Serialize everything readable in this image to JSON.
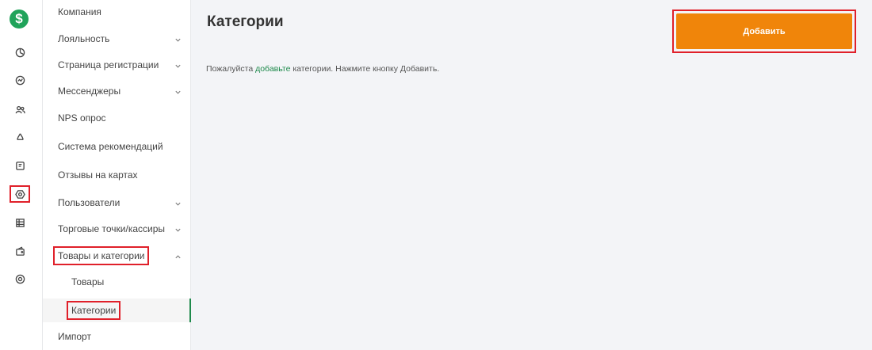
{
  "rail": {
    "logo_glyph": "$",
    "icons": [
      "dashboard-icon",
      "analytics-icon",
      "users-icon",
      "recycle-icon",
      "coupon-icon",
      "settings-icon",
      "table-icon",
      "wallet-icon",
      "support-icon"
    ],
    "active": "settings-icon"
  },
  "sidebar": {
    "items": [
      {
        "label": "Компания"
      },
      {
        "label": "Лояльность",
        "chevron": "down"
      },
      {
        "label": "Страница регистрации",
        "chevron": "down"
      },
      {
        "label": "Мессенджеры",
        "chevron": "down"
      },
      {
        "label": "NPS опрос"
      },
      {
        "label": "Система рекомендаций"
      },
      {
        "label": "Отзывы на картах"
      },
      {
        "label": "Пользователи",
        "chevron": "down"
      },
      {
        "label": "Торговые точки/кассиры",
        "chevron": "down"
      },
      {
        "label": "Товары и категории",
        "chevron": "up"
      },
      {
        "label": "Товары"
      },
      {
        "label": "Категории"
      },
      {
        "label": "Импорт"
      }
    ]
  },
  "main": {
    "title": "Категории",
    "add_label": "Добавить",
    "hint_before": "Пожалуйста ",
    "hint_link": "добавьте",
    "hint_after": " категории. Нажмите кнопку Добавить."
  },
  "colors": {
    "accent": "#f0850a",
    "brand": "#20a35a",
    "link": "#1f8a4c",
    "highlight": "#e0202a"
  }
}
